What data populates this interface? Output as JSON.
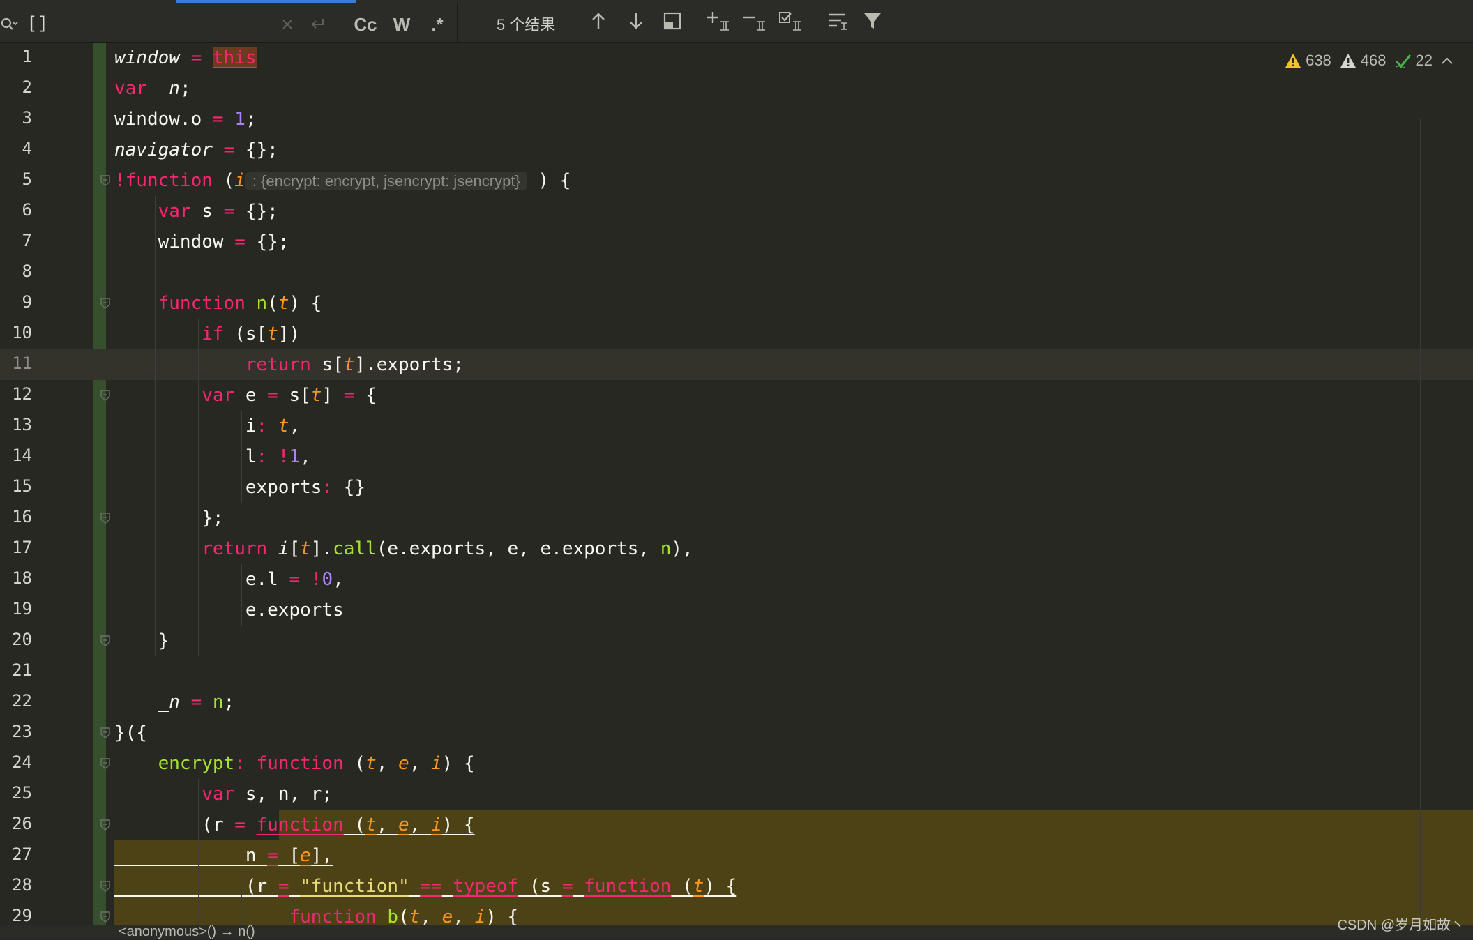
{
  "search": {
    "query": "[]",
    "results_label": "5 个结果",
    "options": {
      "match_case": "Cc",
      "whole_words": "W",
      "regex": ".*"
    }
  },
  "inspections": {
    "warnings_strong": "638",
    "warnings_weak": "468",
    "typos": "22"
  },
  "editor": {
    "caret_line": 11,
    "lines": [
      {
        "n": "1"
      },
      {
        "n": "2"
      },
      {
        "n": "3"
      },
      {
        "n": "4"
      },
      {
        "n": "5"
      },
      {
        "n": "6"
      },
      {
        "n": "7"
      },
      {
        "n": "8"
      },
      {
        "n": "9"
      },
      {
        "n": "10"
      },
      {
        "n": "11"
      },
      {
        "n": "12"
      },
      {
        "n": "13"
      },
      {
        "n": "14"
      },
      {
        "n": "15"
      },
      {
        "n": "16"
      },
      {
        "n": "17"
      },
      {
        "n": "18"
      },
      {
        "n": "19"
      },
      {
        "n": "20"
      },
      {
        "n": "21"
      },
      {
        "n": "22"
      },
      {
        "n": "23"
      },
      {
        "n": "24"
      },
      {
        "n": "25"
      },
      {
        "n": "26"
      },
      {
        "n": "27"
      },
      {
        "n": "28"
      },
      {
        "n": "29"
      }
    ],
    "code": {
      "l1": {
        "a": "window",
        "b": " = ",
        "c": "this"
      },
      "l2": {
        "a": "var",
        "b": " ",
        "c": "_n",
        ";": ";"
      },
      "l3": {
        "a": "window.o",
        "b": " = ",
        "c": "1",
        ";": ";"
      },
      "l4": {
        "a": "navigator",
        "b": " = ",
        "c": "{};"
      },
      "l5": {
        "a": "!function",
        "b": " (",
        "c": "i",
        "hint": ": {encrypt: encrypt, jsencrypt: jsencrypt}",
        "d": " ) {"
      },
      "l6": {
        "a": "var",
        "b": " s ",
        "c": "=",
        "d": " {};"
      },
      "l7": {
        "a": "window",
        "b": " ",
        "c": "=",
        "d": " {};"
      },
      "l9": {
        "a": "function",
        "b": " ",
        "c": "n",
        "d": "(",
        "e": "t",
        "f": ") {"
      },
      "l10": {
        "a": "if",
        "b": " (s[",
        "c": "t",
        "d": "])"
      },
      "l11": {
        "a": "return",
        "b": " s[",
        "c": "t",
        "d": "].exports;"
      },
      "l12": {
        "a": "var",
        "b": " e ",
        "c": "=",
        "d": " s[",
        "e": "t",
        "f": "] ",
        "g": "=",
        "h": " {"
      },
      "l13": {
        "a": "i",
        "b": ":",
        "c": " t",
        ",": ","
      },
      "l14": {
        "a": "l",
        "b": ":",
        "c": " !",
        "d": "1",
        ",": ","
      },
      "l15": {
        "a": "exports",
        "b": ":",
        "c": " {}"
      },
      "l16": {
        "a": "};"
      },
      "l17": {
        "a": "return",
        "b": " i",
        "c": "[",
        "d": "t",
        "e": "].",
        "f": "call",
        "g": "(e.exports, e, e.exports, ",
        "h": "n",
        "i": "),"
      },
      "l18": {
        "a": "e.l",
        "b": " = ",
        "c": "!",
        "d": "0",
        ",": ","
      },
      "l19": {
        "a": "e.exports"
      },
      "l20": {
        "a": "}"
      },
      "l22": {
        "a": "_n",
        "b": " = ",
        "c": "n",
        ";": ";"
      },
      "l23": {
        "a": "}({"
      },
      "l24": {
        "a": "encrypt",
        "b": ": ",
        "c": "function",
        "d": " (",
        "e": "t",
        ",1": ", ",
        "f": "e",
        ",2": ", ",
        "g": "i",
        "h": ") {"
      },
      "l25": {
        "a": "var",
        "b": " s, n, r;"
      },
      "l26": {
        "a": "(r ",
        "b": "=",
        "c": " ",
        "d": "function",
        "e": " (",
        "f": "t",
        ",1": ", ",
        "g": "e",
        ",2": ", ",
        "h": "i",
        "i": ") {"
      },
      "l27": {
        "a": "n ",
        "b": "=",
        "c": " [",
        "d": "e",
        "e": "],"
      },
      "l28": {
        "a": "(r ",
        "b": "=",
        "c": " ",
        "d": "\"function\"",
        "e": " ",
        "f": "==",
        "g": " ",
        "h": "typeof",
        "i": " (s ",
        "j": "=",
        "k": " ",
        "l": "function",
        "m": " (",
        "n": "t",
        "o": ") {"
      },
      "l29": {
        "a": "function",
        "b": " ",
        "c": "b",
        "d": "(",
        "e": "t",
        ",1": ", ",
        "f": "e",
        ",2": ", ",
        "g": "i",
        "h": ") {"
      }
    }
  },
  "breadcrumb": "<anonymous>() → n()",
  "watermark": "CSDN @岁月如故丶"
}
